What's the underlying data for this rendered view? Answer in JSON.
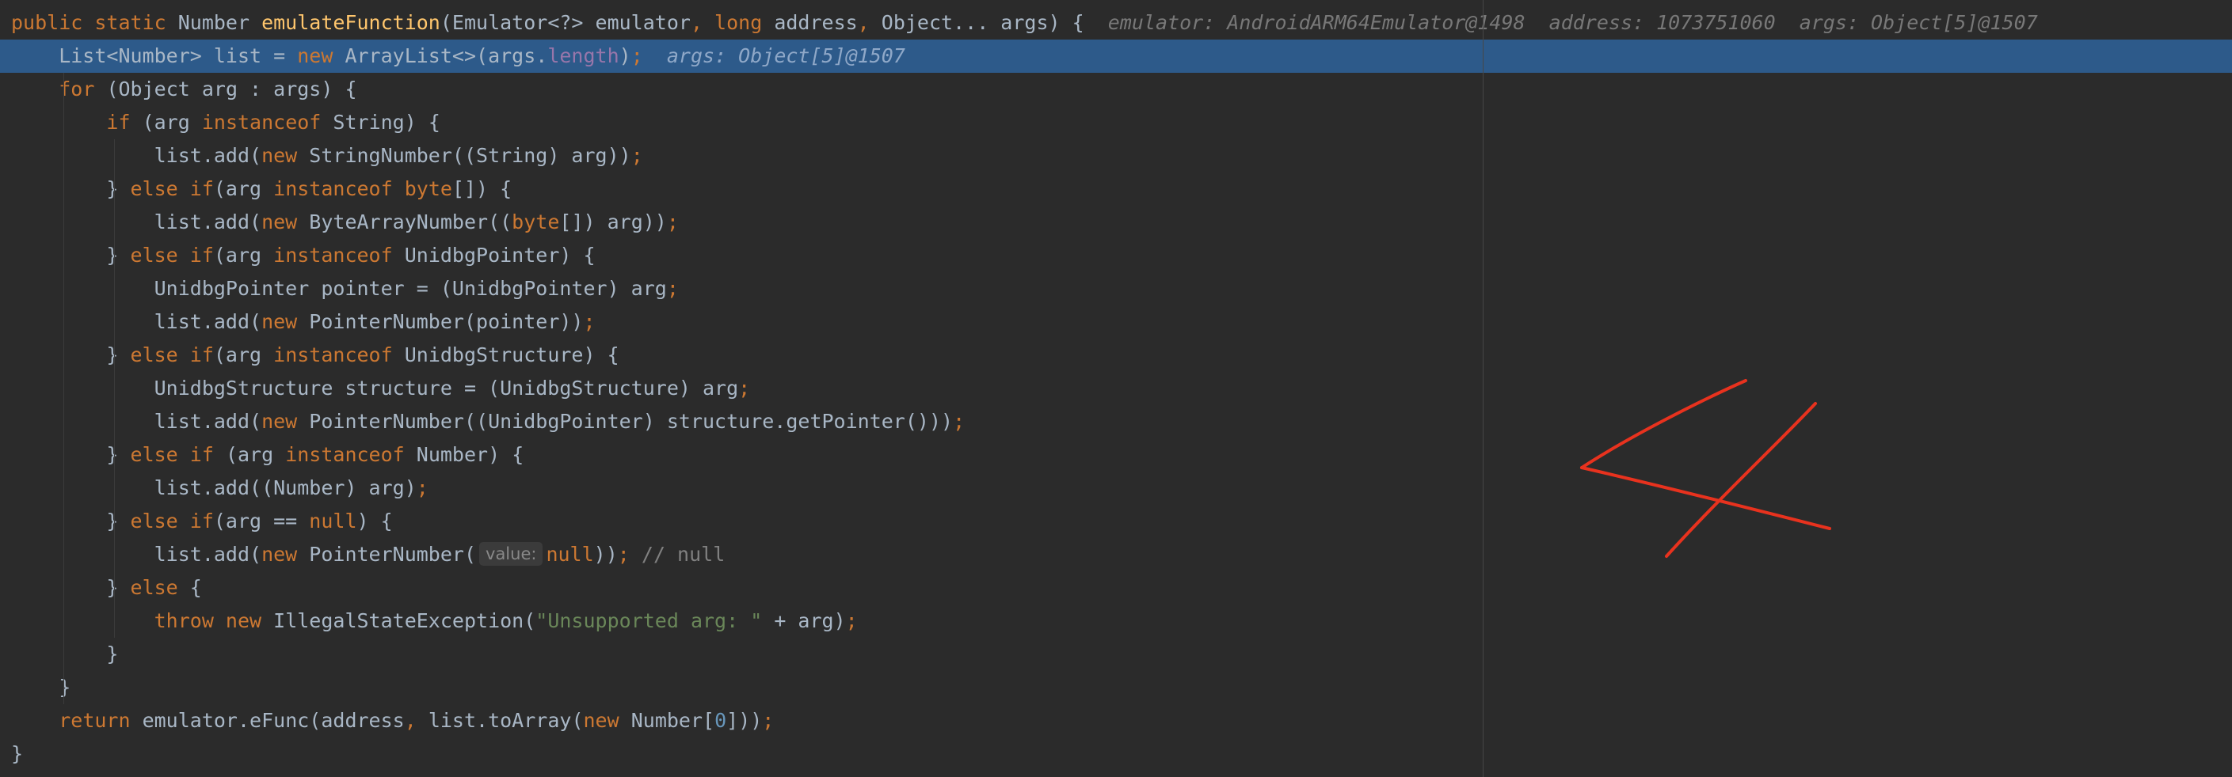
{
  "editor": {
    "language": "java",
    "colors": {
      "background": "#2b2b2b",
      "current_line": "#2d5a8a",
      "keyword": "#cc7832",
      "function": "#ffc66d",
      "string": "#6a8759",
      "number": "#6897bb",
      "field": "#9876aa",
      "comment": "#808080",
      "annotation_stroke": "#e8321e"
    },
    "lines": [
      {
        "tokens": [
          [
            "kw",
            "public "
          ],
          [
            "kw",
            "static "
          ],
          [
            "plain",
            "Number "
          ],
          [
            "fn",
            "emulateFunction"
          ],
          [
            "plain",
            "(Emulator<?> emulator"
          ],
          [
            "kw",
            ", "
          ],
          [
            "kw",
            "long "
          ],
          [
            "plain",
            "address"
          ],
          [
            "kw",
            ", "
          ],
          [
            "plain",
            "Object... args) {"
          ]
        ],
        "debug": "emulator: AndroidARM64Emulator@1498  address: 1073751060  args: Object[5]@1507"
      },
      {
        "current": true,
        "tokens": [
          [
            "plain",
            "    List<Number> list = "
          ],
          [
            "kw",
            "new "
          ],
          [
            "plain",
            "ArrayList<>(args."
          ],
          [
            "field",
            "length"
          ],
          [
            "plain",
            ")"
          ],
          [
            "kw",
            ";"
          ]
        ],
        "debug": "args: Object[5]@1507"
      },
      {
        "tokens": [
          [
            "plain",
            "    "
          ],
          [
            "kw",
            "for "
          ],
          [
            "plain",
            "(Object arg : args) {"
          ]
        ]
      },
      {
        "tokens": [
          [
            "plain",
            "        "
          ],
          [
            "kw",
            "if "
          ],
          [
            "plain",
            "(arg "
          ],
          [
            "kw",
            "instanceof "
          ],
          [
            "plain",
            "String) {"
          ]
        ]
      },
      {
        "tokens": [
          [
            "plain",
            "            list.add("
          ],
          [
            "kw",
            "new "
          ],
          [
            "plain",
            "StringNumber((String) arg))"
          ],
          [
            "kw",
            ";"
          ]
        ]
      },
      {
        "tokens": [
          [
            "plain",
            "        } "
          ],
          [
            "kw",
            "else if"
          ],
          [
            "plain",
            "(arg "
          ],
          [
            "kw",
            "instanceof "
          ],
          [
            "kw",
            "byte"
          ],
          [
            "plain",
            "[]) {"
          ]
        ]
      },
      {
        "tokens": [
          [
            "plain",
            "            list.add("
          ],
          [
            "kw",
            "new "
          ],
          [
            "plain",
            "ByteArrayNumber(("
          ],
          [
            "kw",
            "byte"
          ],
          [
            "plain",
            "[]) arg))"
          ],
          [
            "kw",
            ";"
          ]
        ]
      },
      {
        "tokens": [
          [
            "plain",
            "        } "
          ],
          [
            "kw",
            "else if"
          ],
          [
            "plain",
            "(arg "
          ],
          [
            "kw",
            "instanceof "
          ],
          [
            "plain",
            "UnidbgPointer) {"
          ]
        ]
      },
      {
        "tokens": [
          [
            "plain",
            "            UnidbgPointer pointer = (UnidbgPointer) arg"
          ],
          [
            "kw",
            ";"
          ]
        ]
      },
      {
        "tokens": [
          [
            "plain",
            "            list.add("
          ],
          [
            "kw",
            "new "
          ],
          [
            "plain",
            "PointerNumber(pointer))"
          ],
          [
            "kw",
            ";"
          ]
        ]
      },
      {
        "tokens": [
          [
            "plain",
            "        } "
          ],
          [
            "kw",
            "else if"
          ],
          [
            "plain",
            "(arg "
          ],
          [
            "kw",
            "instanceof "
          ],
          [
            "plain",
            "UnidbgStructure) {"
          ]
        ]
      },
      {
        "tokens": [
          [
            "plain",
            "            UnidbgStructure structure = (UnidbgStructure) arg"
          ],
          [
            "kw",
            ";"
          ]
        ]
      },
      {
        "tokens": [
          [
            "plain",
            "            list.add("
          ],
          [
            "kw",
            "new "
          ],
          [
            "plain",
            "PointerNumber((UnidbgPointer) structure.getPointer()))"
          ],
          [
            "kw",
            ";"
          ]
        ]
      },
      {
        "tokens": [
          [
            "plain",
            "        } "
          ],
          [
            "kw",
            "else if "
          ],
          [
            "plain",
            "(arg "
          ],
          [
            "kw",
            "instanceof "
          ],
          [
            "plain",
            "Number) {"
          ]
        ]
      },
      {
        "tokens": [
          [
            "plain",
            "            list.add((Number) arg)"
          ],
          [
            "kw",
            ";"
          ]
        ]
      },
      {
        "tokens": [
          [
            "plain",
            "        } "
          ],
          [
            "kw",
            "else if"
          ],
          [
            "plain",
            "(arg == "
          ],
          [
            "kw",
            "null"
          ],
          [
            "plain",
            ") {"
          ]
        ]
      },
      {
        "tokens": [
          [
            "plain",
            "            list.add("
          ],
          [
            "kw",
            "new "
          ],
          [
            "plain",
            "PointerNumber("
          ],
          [
            "hint",
            "value:"
          ],
          [
            "kw",
            "null"
          ],
          [
            "plain",
            "))"
          ],
          [
            "kw",
            "; "
          ],
          [
            "comment",
            "// null"
          ]
        ]
      },
      {
        "tokens": [
          [
            "plain",
            "        } "
          ],
          [
            "kw",
            "else "
          ],
          [
            "plain",
            "{"
          ]
        ]
      },
      {
        "tokens": [
          [
            "plain",
            "            "
          ],
          [
            "kw",
            "throw new "
          ],
          [
            "plain",
            "IllegalStateException("
          ],
          [
            "str",
            "\"Unsupported arg: \""
          ],
          [
            "plain",
            " + arg)"
          ],
          [
            "kw",
            ";"
          ]
        ]
      },
      {
        "tokens": [
          [
            "plain",
            "        }"
          ]
        ]
      },
      {
        "tokens": [
          [
            "plain",
            "    }"
          ]
        ]
      },
      {
        "tokens": [
          [
            "plain",
            "    "
          ],
          [
            "kw",
            "return "
          ],
          [
            "plain",
            "emulator.eFunc(address"
          ],
          [
            "kw",
            ", "
          ],
          [
            "plain",
            "list.toArray("
          ],
          [
            "kw",
            "new "
          ],
          [
            "plain",
            "Number["
          ],
          [
            "num",
            "0"
          ],
          [
            "plain",
            "]))"
          ],
          [
            "kw",
            ";"
          ]
        ]
      },
      {
        "tokens": [
          [
            "plain",
            "}"
          ]
        ]
      }
    ]
  }
}
